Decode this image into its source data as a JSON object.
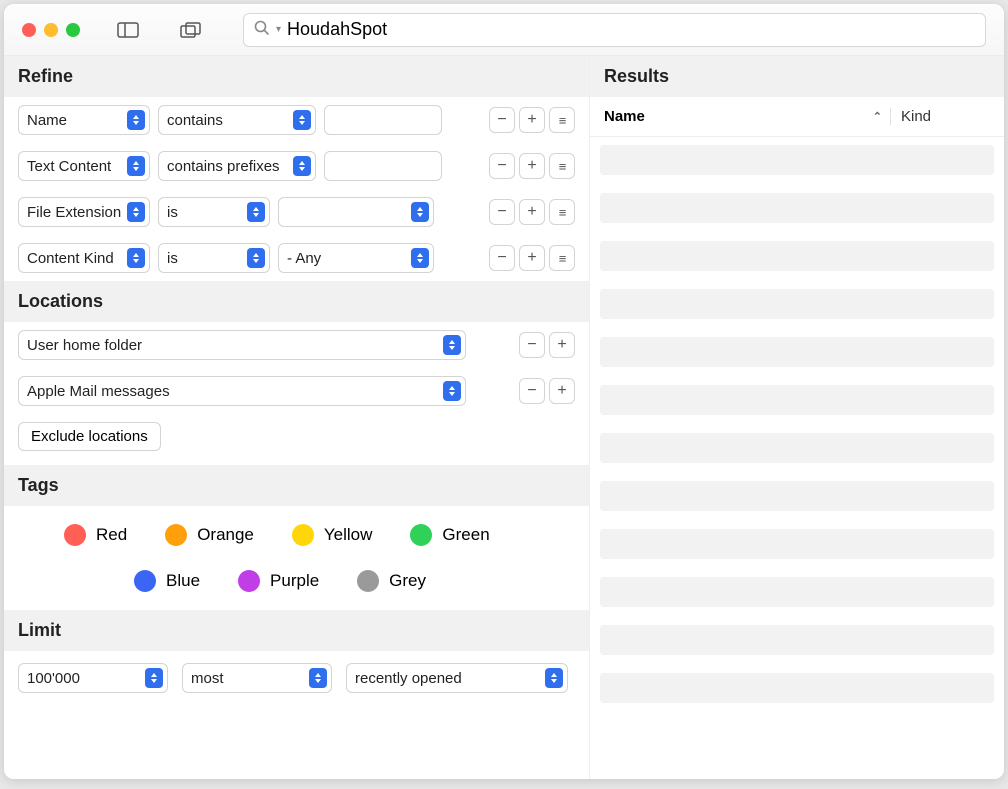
{
  "search": {
    "value": "HoudahSpot"
  },
  "sections": {
    "refine": "Refine",
    "locations": "Locations",
    "tags": "Tags",
    "limit": "Limit",
    "results": "Results"
  },
  "refine": {
    "rows": [
      {
        "attr": "Name",
        "op": "contains",
        "val": ""
      },
      {
        "attr": "Text Content",
        "op": "contains prefixes",
        "val": ""
      },
      {
        "attr": "File Extension",
        "op": "is",
        "val": ""
      },
      {
        "attr": "Content Kind",
        "op": "is",
        "val": "- Any"
      }
    ]
  },
  "locations": {
    "items": [
      {
        "label": "User home folder"
      },
      {
        "label": "Apple Mail messages"
      }
    ],
    "exclude": "Exclude locations"
  },
  "tags": [
    {
      "name": "Red",
      "color": "#ff5f55"
    },
    {
      "name": "Orange",
      "color": "#ff9f0a"
    },
    {
      "name": "Yellow",
      "color": "#ffd60a"
    },
    {
      "name": "Green",
      "color": "#30d158"
    },
    {
      "name": "Blue",
      "color": "#3b66f5"
    },
    {
      "name": "Purple",
      "color": "#c13ee6"
    },
    {
      "name": "Grey",
      "color": "#9a9a9a"
    }
  ],
  "limit": {
    "count": "100'000",
    "direction": "most",
    "criterion": "recently opened"
  },
  "results": {
    "columns": {
      "name": "Name",
      "kind": "Kind"
    }
  }
}
